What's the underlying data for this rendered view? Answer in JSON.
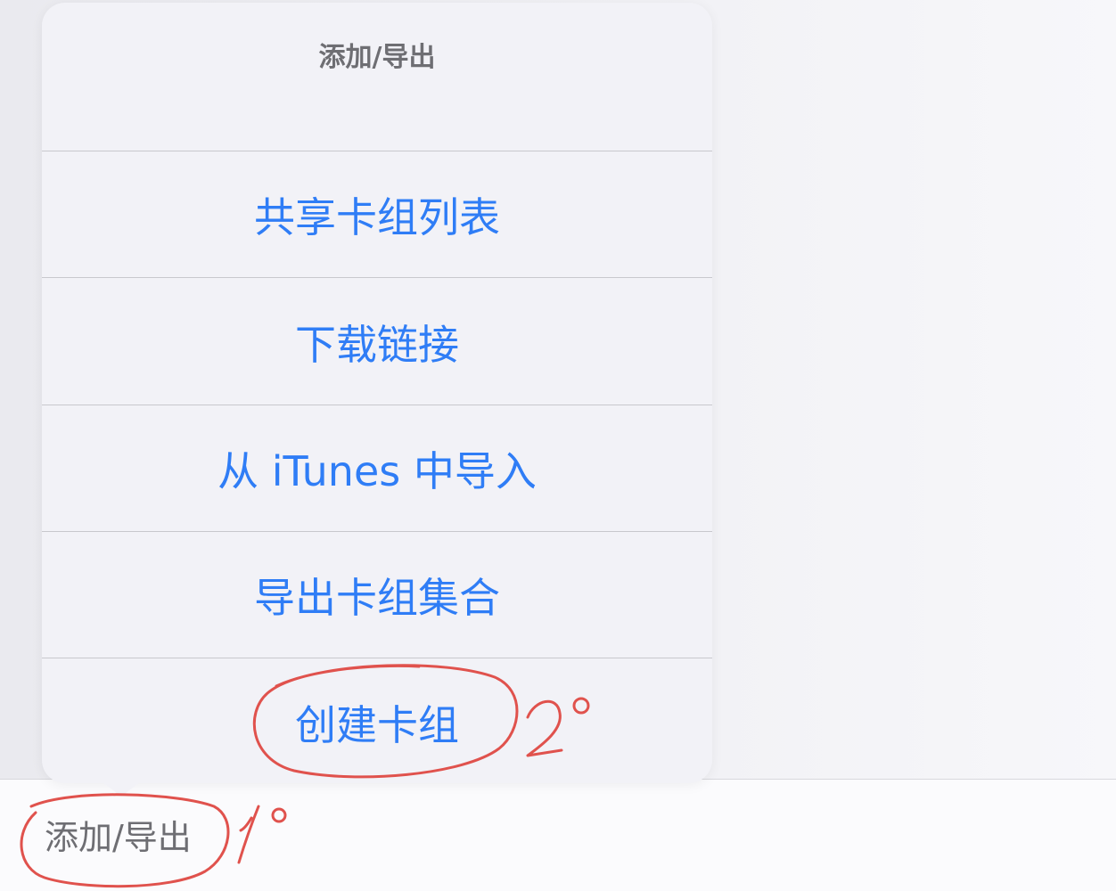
{
  "popover": {
    "title": "添加/导出",
    "items": [
      {
        "label": "共享卡组列表"
      },
      {
        "label": "下载链接"
      },
      {
        "label": "从 iTunes 中导入"
      },
      {
        "label": "导出卡组集合"
      },
      {
        "label": "创建卡组"
      }
    ]
  },
  "toolbar": {
    "add_export_label": "添加/导出"
  },
  "annotations": {
    "step1": "1°",
    "step2": "2°",
    "color": "#e0524d"
  },
  "colors": {
    "accent": "#2f7df6",
    "secondary_text": "#6e6e73",
    "popover_bg": "#f2f2f7"
  }
}
